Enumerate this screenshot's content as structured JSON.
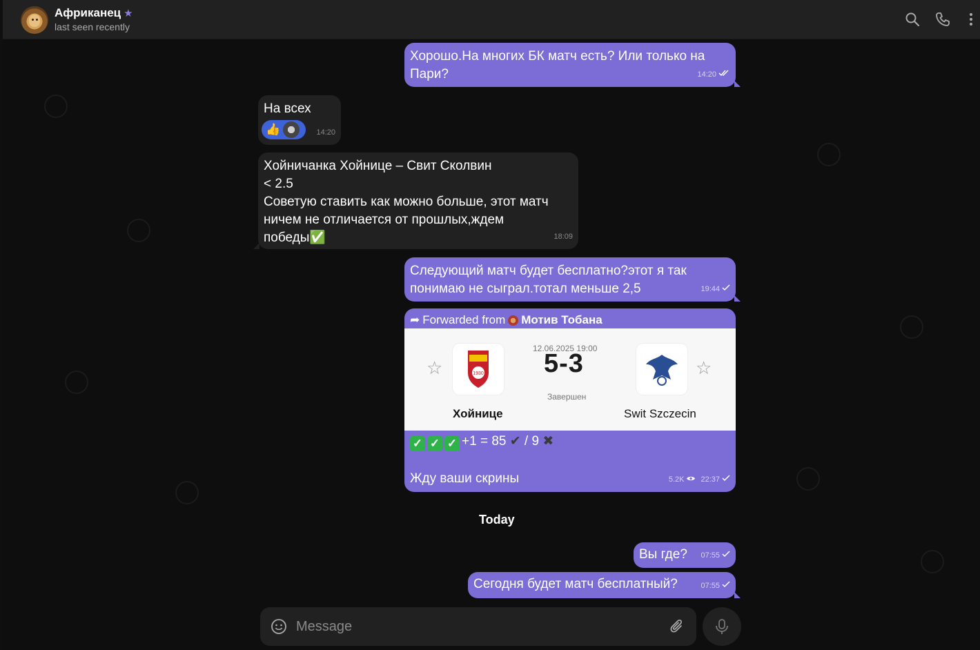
{
  "header": {
    "title": "Африканец",
    "badge_icon": "star-icon",
    "status": "last seen recently",
    "actions": [
      "search-icon",
      "phone-icon",
      "more-vertical-icon"
    ]
  },
  "messages": [
    {
      "id": "m1",
      "direction": "out",
      "text_lines": [
        "Хорошо.На многих БК матч есть? Или только на",
        "Пари?"
      ],
      "time": "14:20",
      "read": "double-check"
    },
    {
      "id": "m2",
      "direction": "in",
      "text": "На всех",
      "time": "14:20",
      "reactions": [
        "👍",
        "avatar"
      ]
    },
    {
      "id": "m3",
      "direction": "in",
      "text_lines": [
        "Хойничанка Хойнице – Свит Сколвин",
        "< 2.5",
        "Советую ставить как можно больше, этот матч",
        "ничем не отличается от прошлых,ждем",
        "победы"
      ],
      "trailing_emoji": "✅",
      "time": "18:09"
    },
    {
      "id": "m4",
      "direction": "out",
      "text_lines": [
        "Следующий матч будет бесплатно?этот я так",
        "понимаю не сыграл.тотал меньше 2,5"
      ],
      "time": "19:44",
      "read": "check"
    },
    {
      "id": "m5",
      "direction": "out",
      "forwarded": true,
      "forward_prefix": "Forwarded from",
      "forward_source": "Мотив Тобана",
      "match": {
        "date": "12.06.2025 19:00",
        "score": "5-3",
        "status": "Завершен",
        "home": "Хойнице",
        "away": "Swit Szczecin",
        "home_logo_year": "1930"
      },
      "tally": {
        "prefix_checks": "✅✅✅",
        "text": "+1 = 85",
        "check_mark": "✔",
        "sep": " / 9 ",
        "cross": "✖"
      },
      "text": "Жду ваши скрины",
      "views": "5.2K",
      "time": "22:37",
      "read": "check"
    },
    {
      "id": "m6",
      "direction": "out",
      "text": "Вы где?",
      "time": "07:55",
      "read": "check"
    },
    {
      "id": "m7",
      "direction": "out",
      "text": "Сегодня будет матч бесплатный?",
      "time": "07:55",
      "read": "check"
    }
  ],
  "day_separator": "Today",
  "composer": {
    "placeholder": "Message",
    "icons": [
      "emoji-icon",
      "attach-icon",
      "mic-icon"
    ]
  },
  "colors": {
    "outgoing": "#7b6cd6",
    "incoming": "#212121",
    "background": "#0e0e0e",
    "header": "#212121",
    "reaction": "#3e63d8"
  }
}
